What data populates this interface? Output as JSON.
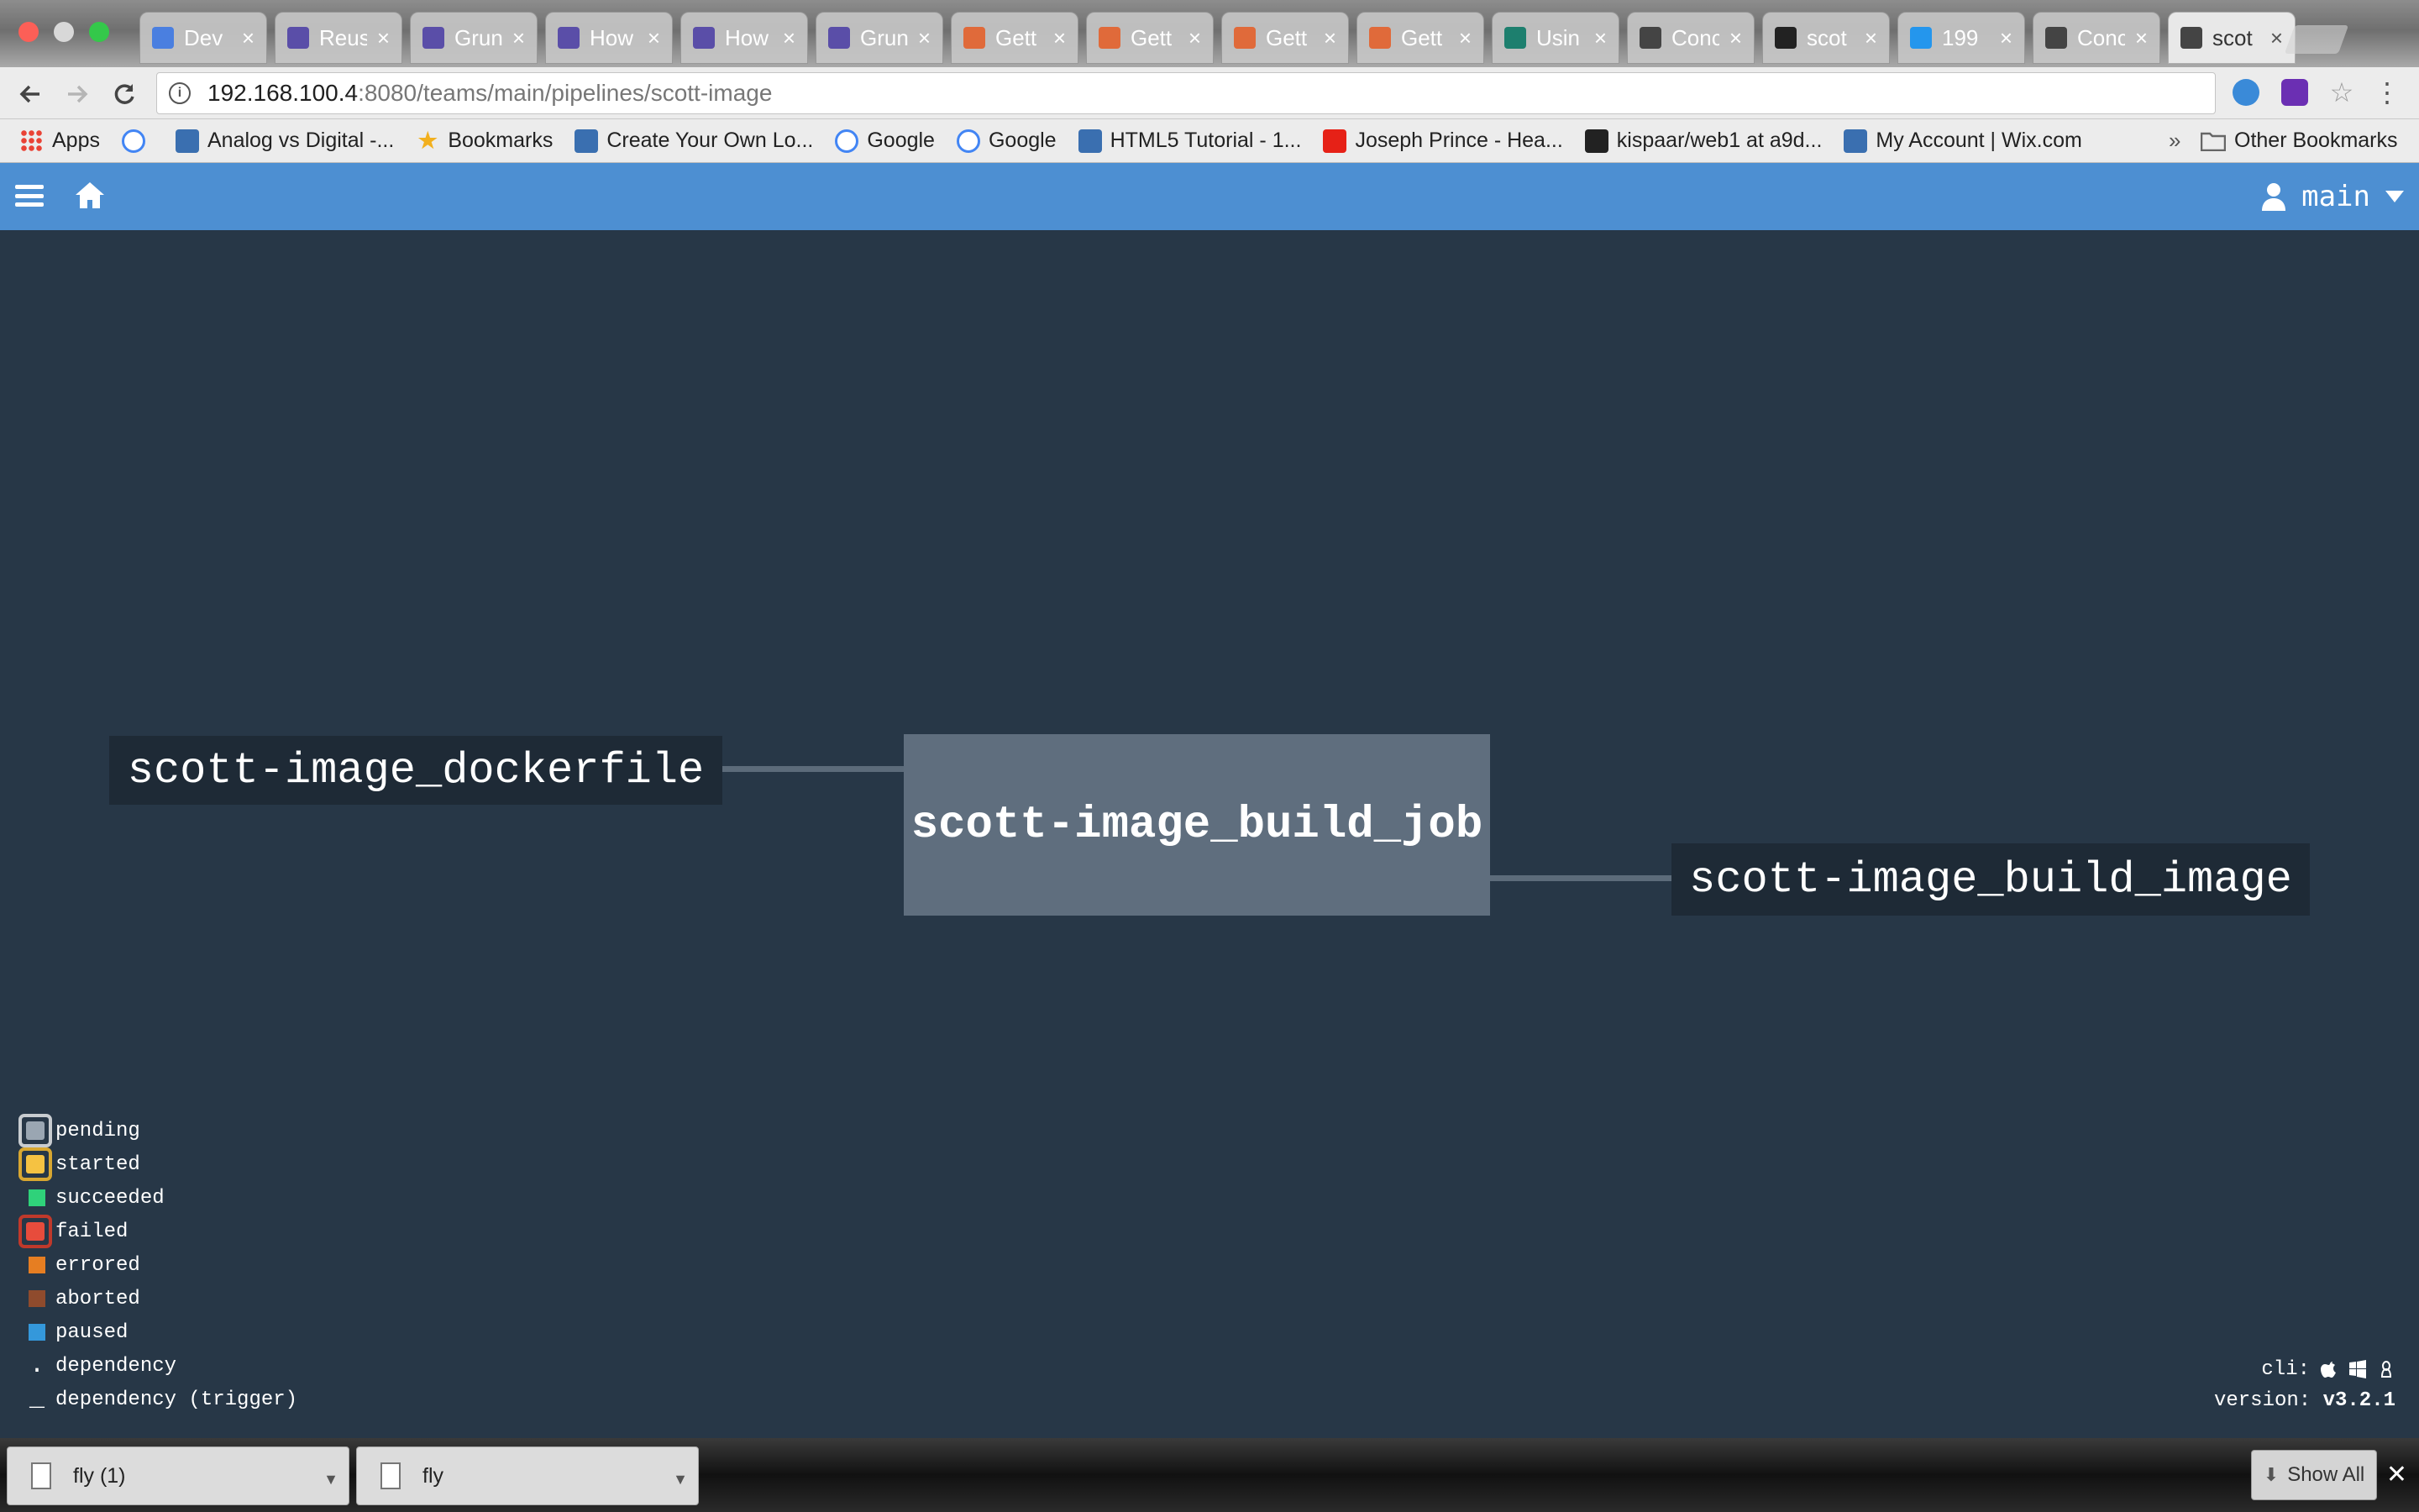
{
  "browser": {
    "tabs": [
      {
        "label": "Dev",
        "favicon": "docs-icon",
        "color": "#4a7fe0"
      },
      {
        "label": "Reus",
        "favicon": "octopus-icon",
        "color": "#5a4ea8"
      },
      {
        "label": "Grun",
        "favicon": "octopus-icon",
        "color": "#5a4ea8"
      },
      {
        "label": "How",
        "favicon": "octopus-icon",
        "color": "#5a4ea8"
      },
      {
        "label": "How",
        "favicon": "octopus-icon",
        "color": "#5a4ea8"
      },
      {
        "label": "Grun",
        "favicon": "octopus-icon",
        "color": "#5a4ea8"
      },
      {
        "label": "Gett",
        "favicon": "swirl-icon",
        "color": "#e06a3a"
      },
      {
        "label": "Gett",
        "favicon": "swirl-icon",
        "color": "#e06a3a"
      },
      {
        "label": "Gett",
        "favicon": "swirl-icon",
        "color": "#e06a3a"
      },
      {
        "label": "Gett",
        "favicon": "swirl-icon",
        "color": "#e06a3a"
      },
      {
        "label": "Usin",
        "favicon": "p-icon",
        "color": "#1d7f6e"
      },
      {
        "label": "Conc",
        "favicon": "concourse-icon",
        "color": "#444"
      },
      {
        "label": "scot",
        "favicon": "github-icon",
        "color": "#222"
      },
      {
        "label": "199",
        "favicon": "docker-icon",
        "color": "#2496ed"
      },
      {
        "label": "Conc",
        "favicon": "concourse-icon",
        "color": "#444"
      },
      {
        "label": "scot",
        "favicon": "concourse-icon",
        "color": "#444",
        "active": true
      }
    ],
    "url_host": "192.168.100.4",
    "url_rest": ":8080/teams/main/pipelines/scott-image",
    "bookmarks": [
      {
        "label": "Apps",
        "icon": "apps-grid-icon"
      },
      {
        "label": "",
        "icon": "google-icon"
      },
      {
        "label": "Analog vs Digital -...",
        "icon": "bookmark-page-icon"
      },
      {
        "label": "Bookmarks",
        "icon": "star-icon"
      },
      {
        "label": "Create Your Own Lo...",
        "icon": "bookmark-page-icon"
      },
      {
        "label": "Google",
        "icon": "google-icon"
      },
      {
        "label": "Google",
        "icon": "google-icon"
      },
      {
        "label": "HTML5 Tutorial - 1...",
        "icon": "bookmark-page-icon"
      },
      {
        "label": "Joseph Prince - Hea...",
        "icon": "youtube-icon"
      },
      {
        "label": "kispaar/web1 at a9d...",
        "icon": "github-icon"
      },
      {
        "label": "My Account | Wix.com",
        "icon": "bookmark-page-icon"
      }
    ],
    "bookmarks_overflow": "»",
    "other_bookmarks": "Other Bookmarks"
  },
  "topbar": {
    "team": "main"
  },
  "pipeline": {
    "input_resource": "scott-image_dockerfile",
    "job": "scott-image_build_job",
    "output_resource": "scott-image_build_image"
  },
  "legend": [
    {
      "label": "pending",
      "color": "#9aa6b2",
      "ring": true,
      "ring_color": "#c8ccd0"
    },
    {
      "label": "started",
      "color": "#f5c242",
      "ring": true,
      "ring_color": "#d8a731"
    },
    {
      "label": "succeeded",
      "color": "#2fd27a",
      "ring": false
    },
    {
      "label": "failed",
      "color": "#e74c3c",
      "ring": true,
      "ring_color": "#c0392b"
    },
    {
      "label": "errored",
      "color": "#e67e22",
      "ring": false
    },
    {
      "label": "aborted",
      "color": "#8f4b2d",
      "ring": false
    },
    {
      "label": "paused",
      "color": "#3498db",
      "ring": false
    },
    {
      "label": "dependency",
      "symbol": "."
    },
    {
      "label": "dependency (trigger)",
      "symbol": "_"
    }
  ],
  "footer": {
    "cli_label": "cli:",
    "version_label": "version:",
    "version": "v3.2.1"
  },
  "downloads": {
    "items": [
      {
        "label": "fly (1)"
      },
      {
        "label": "fly"
      }
    ],
    "show_all": "Show All"
  }
}
